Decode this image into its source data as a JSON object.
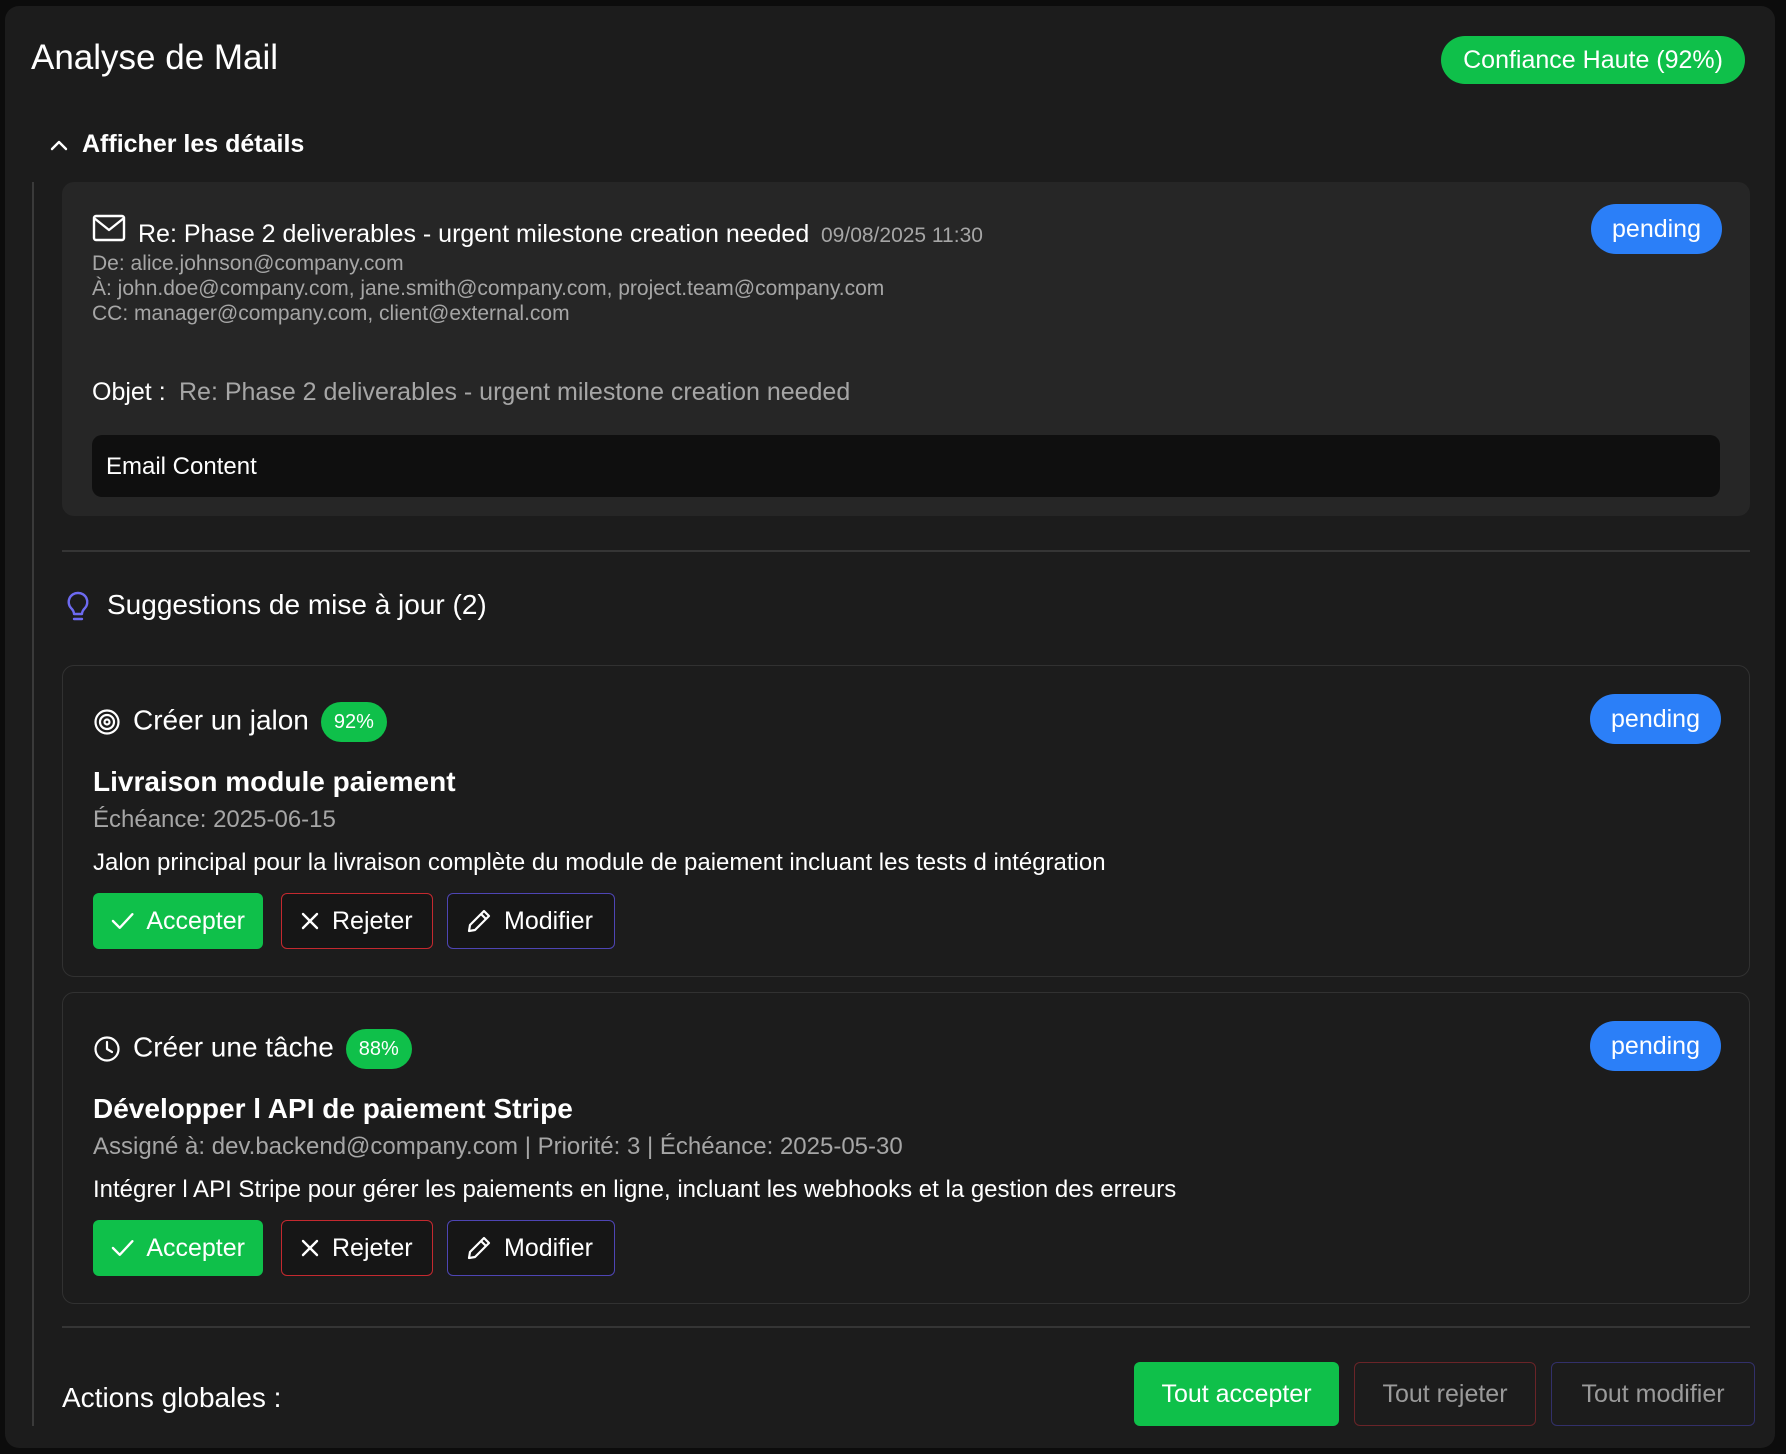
{
  "header": {
    "title": "Analyse de Mail",
    "confidence_badge": "Confiance Haute (92%)"
  },
  "details_toggle": {
    "label": "Afficher les détails",
    "icon": "chevron-up-icon"
  },
  "email": {
    "icon": "mail-icon",
    "subject": "Re: Phase 2 deliverables - urgent milestone creation needed",
    "date": "09/08/2025 11:30",
    "status": "pending",
    "from": "De: alice.johnson@company.com",
    "to": "À: john.doe@company.com, jane.smith@company.com, project.team@company.com",
    "cc": "CC: manager@company.com, client@external.com",
    "object_label": "Objet :",
    "object_value": "Re: Phase 2 deliverables - urgent milestone creation needed",
    "content": "Email Content"
  },
  "suggestions": {
    "heading": "Suggestions de mise à jour (2)",
    "icon": "lightbulb-icon",
    "items": [
      {
        "type": "Créer un jalon",
        "icon": "target-icon",
        "confidence": "92%",
        "status": "pending",
        "title": "Livraison module paiement",
        "meta": "Échéance: 2025-06-15",
        "description": "Jalon principal pour la livraison complète du module de paiement incluant les tests d intégration",
        "accept": "Accepter",
        "reject": "Rejeter",
        "modify": "Modifier"
      },
      {
        "type": "Créer une tâche",
        "icon": "clock-icon",
        "confidence": "88%",
        "status": "pending",
        "title": "Développer l API de paiement Stripe",
        "meta": "Assigné à: dev.backend@company.com | Priorité: 3 | Échéance: 2025-05-30",
        "description": "Intégrer l API Stripe pour gérer les paiements en ligne, incluant les webhooks et la gestion des erreurs",
        "accept": "Accepter",
        "reject": "Rejeter",
        "modify": "Modifier"
      }
    ]
  },
  "global_actions": {
    "label": "Actions globales :",
    "accept_all": "Tout accepter",
    "reject_all": "Tout rejeter",
    "modify_all": "Tout modifier"
  },
  "colors": {
    "accent_green": "#0fc04a",
    "status_blue": "#2b7ff8",
    "reject_red": "#c4292f",
    "modify_purple": "#4e45b4",
    "lightbulb_purple": "#6d6af0"
  }
}
